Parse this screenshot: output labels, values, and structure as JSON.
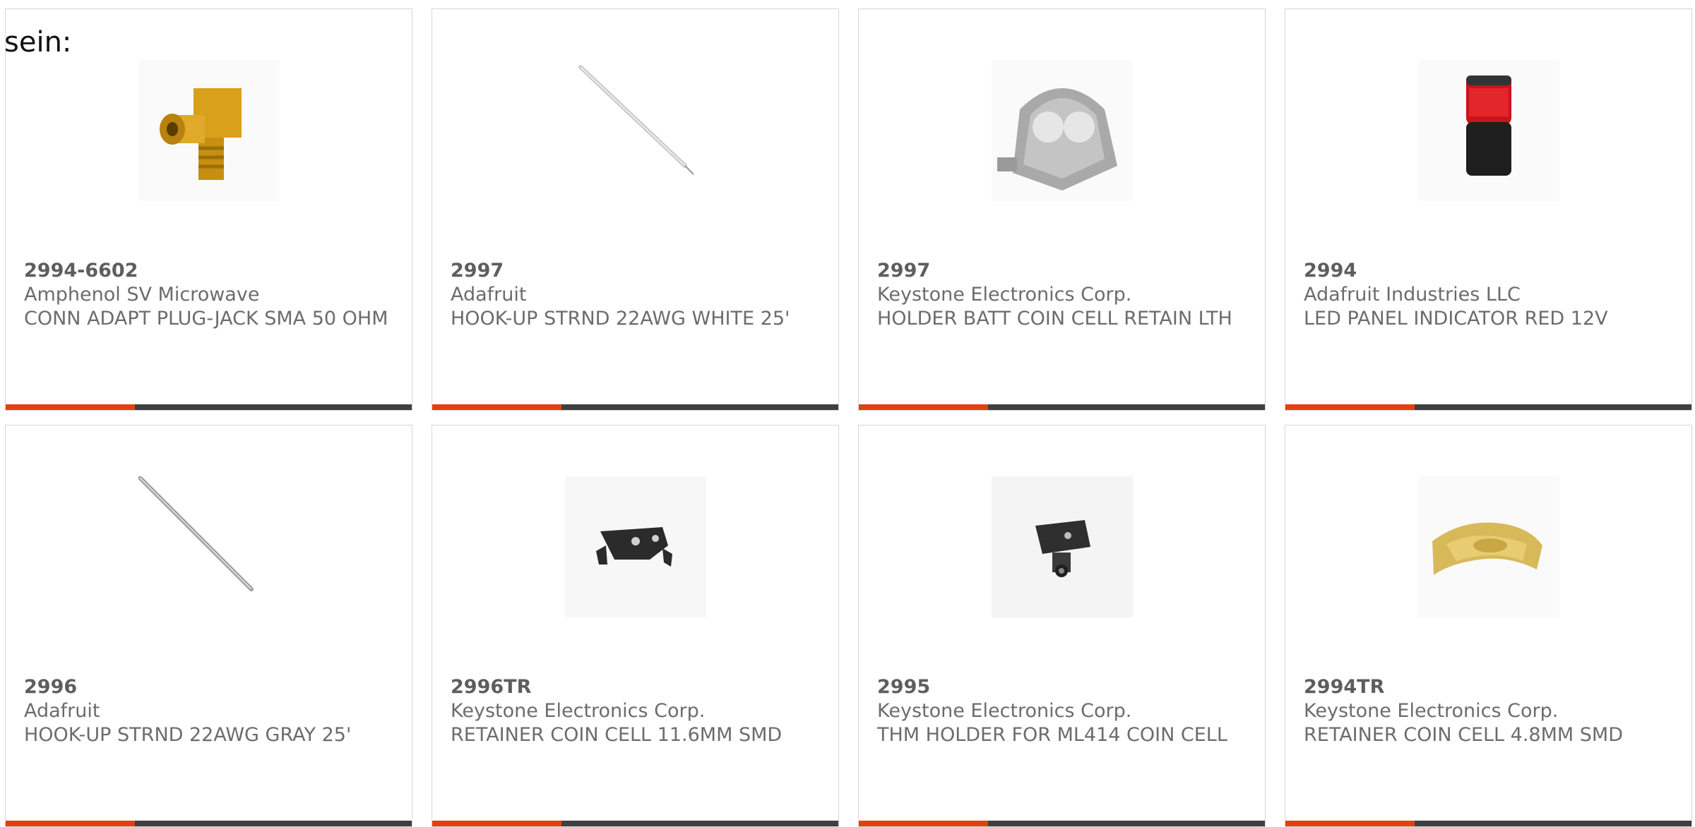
{
  "top_text": "sein:",
  "colors": {
    "accent": "#e2410f",
    "bar": "#3f3f3f",
    "border": "#d6d6d6"
  },
  "cards": [
    {
      "part": "2994-6602",
      "mfr": "Amphenol SV Microwave",
      "desc": "CONN ADAPT PLUG-JACK SMA 50 OHM",
      "icon": "sma-adapter-icon"
    },
    {
      "part": "2997",
      "mfr": "Adafruit",
      "desc": "HOOK-UP STRND 22AWG WHITE 25'",
      "icon": "wire-icon"
    },
    {
      "part": "2997",
      "mfr": "Keystone Electronics Corp.",
      "desc": "HOLDER BATT COIN CELL RETAIN LTH",
      "icon": "coin-holder-icon"
    },
    {
      "part": "2994",
      "mfr": "Adafruit Industries LLC",
      "desc": "LED PANEL INDICATOR RED 12V",
      "icon": "led-indicator-icon"
    },
    {
      "part": "2996",
      "mfr": "Adafruit",
      "desc": "HOOK-UP STRND 22AWG GRAY 25'",
      "icon": "wire-icon"
    },
    {
      "part": "2996TR",
      "mfr": "Keystone Electronics Corp.",
      "desc": "RETAINER COIN CELL 11.6MM SMD",
      "icon": "retainer-icon"
    },
    {
      "part": "2995",
      "mfr": "Keystone Electronics Corp.",
      "desc": "THM HOLDER FOR ML414 COIN CELL",
      "icon": "thm-holder-icon"
    },
    {
      "part": "2994TR",
      "mfr": "Keystone Electronics Corp.",
      "desc": "RETAINER COIN CELL 4.8MM SMD",
      "icon": "gold-retainer-icon"
    }
  ]
}
